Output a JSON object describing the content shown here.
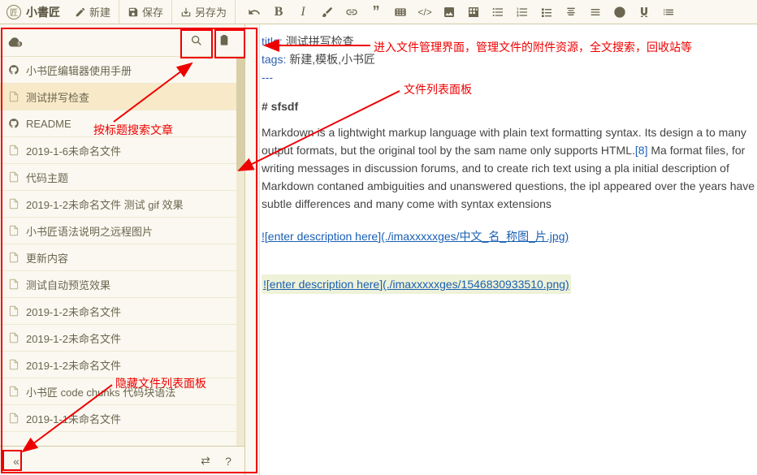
{
  "app": {
    "name": "小書匠"
  },
  "toolbar": {
    "new": "新建",
    "save": "保存",
    "save_as": "另存为"
  },
  "sidebar": {
    "items": [
      {
        "label": "小书匠编辑器使用手册",
        "icon": "github"
      },
      {
        "label": "测试拼写检查",
        "icon": "file",
        "selected": true
      },
      {
        "label": "README",
        "icon": "github"
      },
      {
        "label": "2019-1-6未命名文件",
        "icon": "file"
      },
      {
        "label": "代码主题",
        "icon": "file"
      },
      {
        "label": "2019-1-2未命名文件 测试 gif 效果",
        "icon": "file"
      },
      {
        "label": "小书匠语法说明之远程图片",
        "icon": "file"
      },
      {
        "label": "更新内容",
        "icon": "file"
      },
      {
        "label": "测试自动预览效果",
        "icon": "file"
      },
      {
        "label": "2019-1-2未命名文件",
        "icon": "file"
      },
      {
        "label": "2019-1-2未命名文件",
        "icon": "file"
      },
      {
        "label": "2019-1-2未命名文件",
        "icon": "file"
      },
      {
        "label": "小书匠 code chunks 代码块语法",
        "icon": "file"
      },
      {
        "label": "2019-1-1未命名文件",
        "icon": "file"
      }
    ]
  },
  "editor": {
    "title_key": "title:",
    "title_val": " 测试拼写检查",
    "tags_key": "tags:",
    "tags_val": " 新建,模板,小书匠",
    "divider": "---",
    "heading": "# sfsdf",
    "para": "Markdown is a lightwight markup language with plain text formatting syntax. Its design a to many output formats, but the original tool by the sam name only supports HTML.",
    "ref": "[8]",
    "para2": " Ma format files, for writing messages in discussion forums, and to create rich text using a pla initial description of Markdown contaned ambiguities and unanswered questions, the ipl appeared over the years have subtle differences and many come with syntax extensions",
    "img1": "![enter description here](./imaxxxxxges/中文_名_称图_片.jpg)",
    "img2": "![enter description here](./imaxxxxxges/1546830933510.png)"
  },
  "annotations": {
    "manage": "进入文件管理界面，管理文件的附件资源，全文搜索，回收站等",
    "search": "按标题搜索文章",
    "panel": "文件列表面板",
    "hide": "隐藏文件列表面板"
  }
}
